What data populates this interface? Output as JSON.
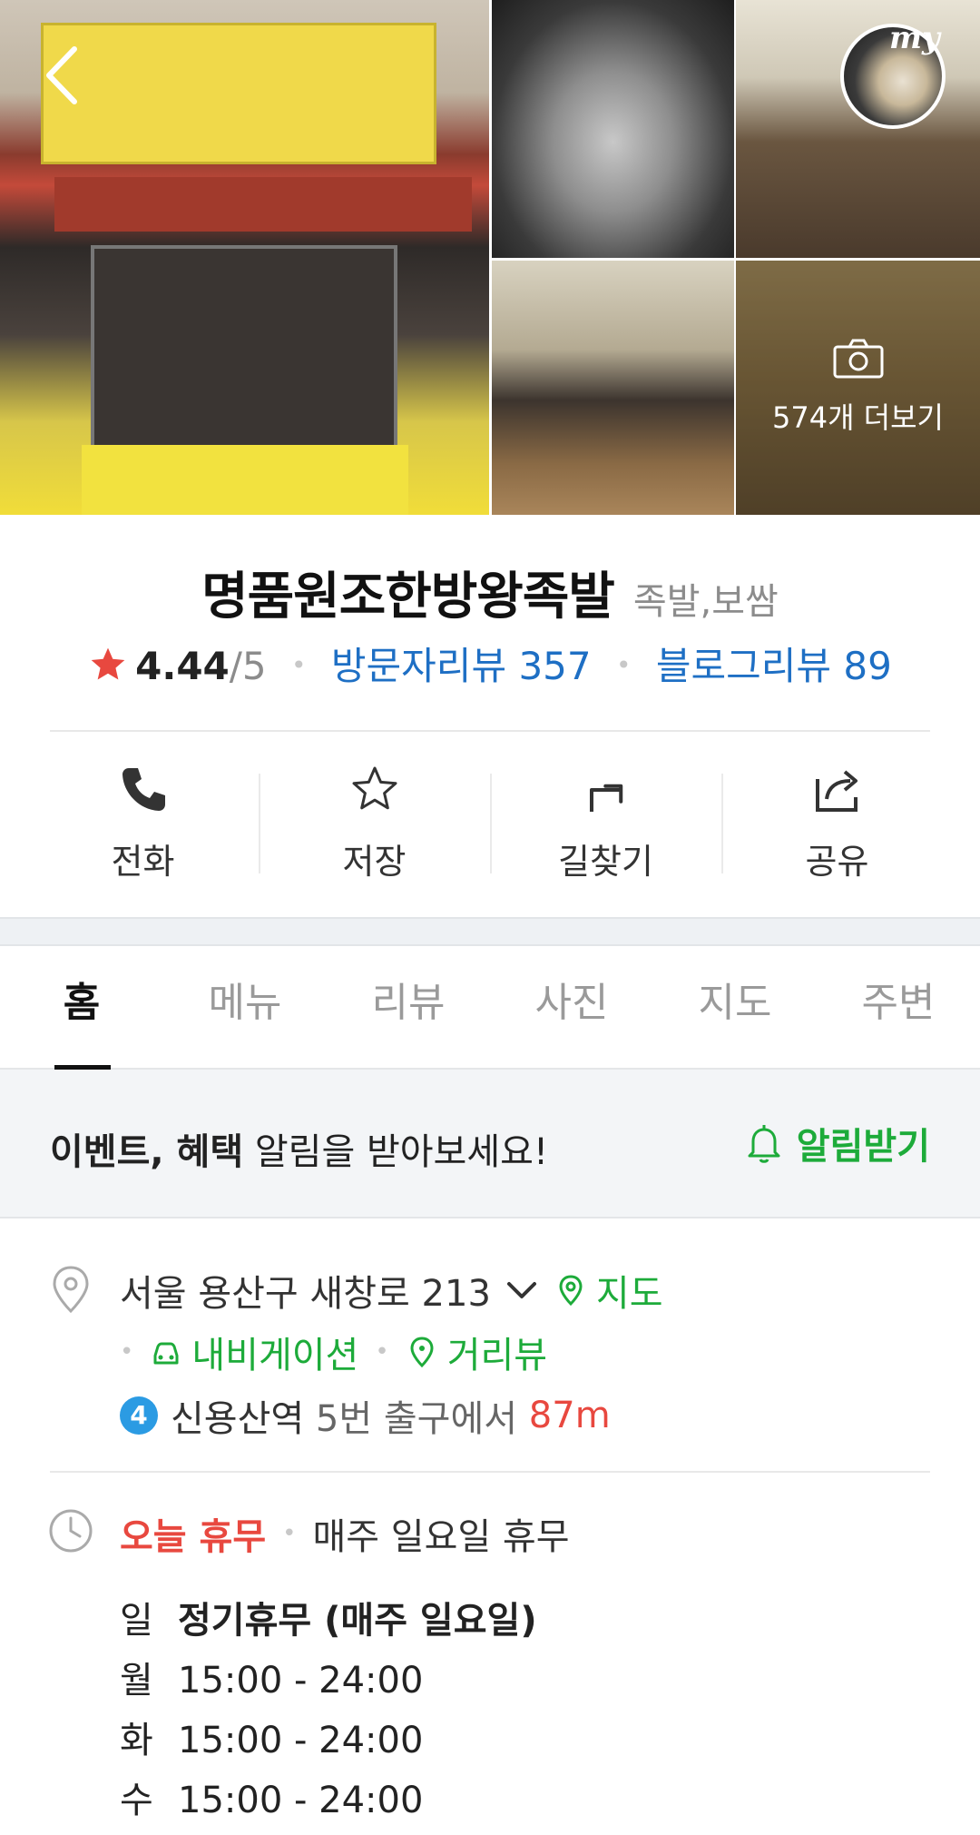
{
  "gallery": {
    "more_label": "574개 더보기",
    "my_label": "my"
  },
  "place": {
    "name": "명품원조한방왕족발",
    "category": "족발,보쌈",
    "score": "4.44",
    "score_max": "/5",
    "visitor_reviews": "방문자리뷰 357",
    "blog_reviews": "블로그리뷰 89"
  },
  "actions": [
    {
      "label": "전화",
      "icon": "phone-icon"
    },
    {
      "label": "저장",
      "icon": "star-outline-icon"
    },
    {
      "label": "길찾기",
      "icon": "directions-icon"
    },
    {
      "label": "공유",
      "icon": "share-icon"
    }
  ],
  "tabs": [
    "홈",
    "메뉴",
    "리뷰",
    "사진",
    "지도",
    "주변"
  ],
  "notice": {
    "bold": "이벤트, 혜택",
    "rest": " 알림을 받아보세요!",
    "button": "알림받기"
  },
  "address": {
    "text": "서울 용산구 새창로 213",
    "map_link": "지도",
    "navigation": "내비게이션",
    "street_view": "거리뷰",
    "subway_line": "4",
    "station": "신용산역",
    "exit_text": " 5번 출구에서 ",
    "distance": "87m"
  },
  "hours": {
    "today_status": "오늘 휴무",
    "regular_note": "매주 일요일 휴무",
    "rows": [
      {
        "day": "일",
        "time": "정기휴무 (매주 일요일)"
      },
      {
        "day": "월",
        "time": "15:00 - 24:00"
      },
      {
        "day": "화",
        "time": "15:00 - 24:00"
      },
      {
        "day": "수",
        "time": "15:00 - 24:00"
      }
    ]
  },
  "colors": {
    "green": "#1dab3a",
    "blue": "#1e6fc4",
    "red": "#e8483f",
    "star": "#e8483f"
  }
}
